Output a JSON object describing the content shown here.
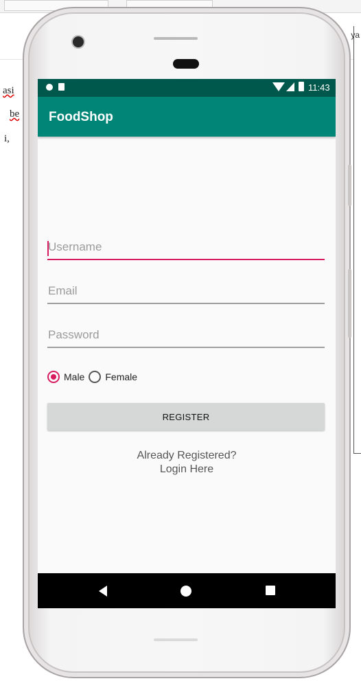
{
  "background_doc": {
    "words": [
      "asi",
      "be",
      "i,"
    ],
    "right_text": "ya"
  },
  "status_bar": {
    "time": "11:43"
  },
  "app_bar": {
    "title": "FoodShop"
  },
  "form": {
    "username_placeholder": "Username",
    "email_placeholder": "Email",
    "password_placeholder": "Password",
    "gender_options": [
      {
        "label": "Male",
        "checked": true
      },
      {
        "label": "Female",
        "checked": false
      }
    ],
    "register_label": "REGISTER",
    "login_line1": "Already Registered?",
    "login_line2": "Login Here"
  },
  "colors": {
    "primary": "#008577",
    "primary_dark": "#00574b",
    "accent": "#d81b60"
  },
  "nav_icons": [
    "back-icon",
    "home-icon",
    "recents-icon"
  ]
}
